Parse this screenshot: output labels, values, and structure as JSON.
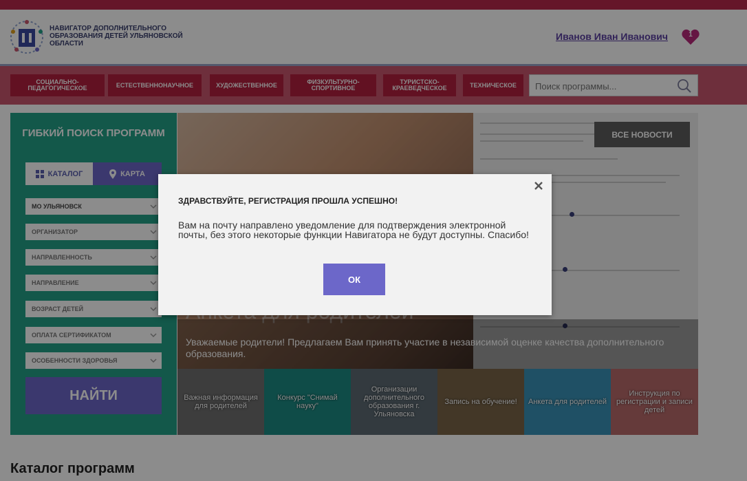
{
  "header": {
    "logo_text": "НАВИГАТОР ДОПОЛНИТЕЛЬНОГО ОБРАЗОВАНИЯ ДЕТЕЙ УЛЬЯНОВСКОЙ ОБЛАСТИ",
    "user_name": "Иванов Иван Иванович",
    "favorites_count": "1"
  },
  "nav": {
    "items": [
      "СОЦИАЛЬНО-ПЕДАГОГИЧЕСКОЕ",
      "ЕСТЕСТВЕННОНАУЧНОЕ",
      "ХУДОЖЕСТВЕННОЕ",
      "ФИЗКУЛЬТУРНО-СПОРТИВНОЕ",
      "ТУРИСТСКО-КРАЕВЕДЧЕСКОЕ",
      "ТЕХНИЧЕСКОЕ"
    ],
    "search_placeholder": "Поиск программы..."
  },
  "sidebar": {
    "title": "ГИБКИЙ ПОИСК ПРОГРАММ",
    "tab_catalog": "КАТАЛОГ",
    "tab_map": "КАРТА",
    "filters": [
      "МО УЛЬЯНОВСК",
      "ОРГАНИЗАТОР",
      "НАПРАВЛЕННОСТЬ",
      "НАПРАВЛЕНИЕ",
      "ВОЗРАСТ ДЕТЕЙ",
      "ОПЛАТА СЕРТИФИКАТОМ",
      "ОСОБЕННОСТИ ЗДОРОВЬЯ"
    ],
    "find_button": "НАЙТИ"
  },
  "banner": {
    "news_button": "ВСЕ НОВОСТИ",
    "heading": "Анкета для родителей",
    "caption": "Уважаемые родители! Предлагаем Вам принять участие в независимой оценке качества дополнительного образования."
  },
  "thumbs": [
    "Важная информация для родителей",
    "Конкурс \"Снимай науку\"",
    "Организации дополнительного образования г. Ульяновска",
    "Запись на обучение!",
    "Анкета для родителей",
    "Инструкция по регистрации и записи детей"
  ],
  "catalog_title": "Каталог программ",
  "modal": {
    "title": "ЗДРАВСТВУЙТЕ, РЕГИСТРАЦИЯ ПРОШЛА УСПЕШНО!",
    "text": "Вам на почту направлено уведомление для подтверждения электронной почты,  без этого некоторые функции Навигатора не будут доступны. Спасибо!",
    "ok_button": "ОК"
  },
  "colors": {
    "nav_bg": "#c8576d",
    "nav_button": "#b21f3f",
    "sidebar_bg": "#23a088",
    "accent_purple": "#6c67c9",
    "user_link": "#5a3fa0"
  }
}
